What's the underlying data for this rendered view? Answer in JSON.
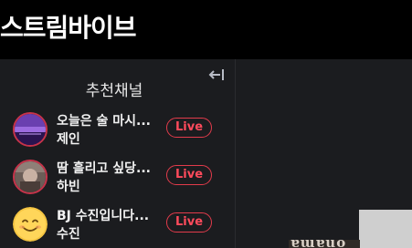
{
  "header": {
    "logo_text": "스트림바이브"
  },
  "sidebar": {
    "collapse_icon": "collapse-left-icon",
    "title": "추천채널",
    "live_label": "Live",
    "live_color": "#e23b4b",
    "channels": [
      {
        "title": "오늘은 술 마시...",
        "name": "제인"
      },
      {
        "title": "땀 흘리고 싶당...",
        "name": "하빈"
      },
      {
        "title": "BJ 수진입니다...",
        "name": "수진"
      }
    ]
  }
}
